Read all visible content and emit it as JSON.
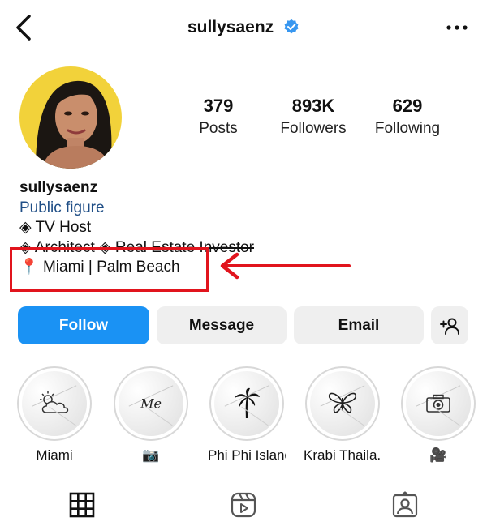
{
  "header": {
    "username": "sullysaenz",
    "back_icon": "chevron-left-icon",
    "verified_icon": "verified-badge-icon",
    "more_icon": "more-horizontal-icon"
  },
  "stats": [
    {
      "value": "379",
      "label": "Posts"
    },
    {
      "value": "893K",
      "label": "Followers"
    },
    {
      "value": "629",
      "label": "Following"
    }
  ],
  "bio": {
    "name": "sullysaenz",
    "category": "Public figure",
    "line1": "◈ TV Host",
    "line2": "◈ Architect ◈ Real Estate Investor",
    "location_icon": "📍",
    "location": "Miami | Palm Beach"
  },
  "actions": {
    "follow": "Follow",
    "message": "Message",
    "email": "Email",
    "add_user_icon": "add-user-icon"
  },
  "highlights": [
    {
      "label": "Miami",
      "icon": "cloud-sun-icon"
    },
    {
      "label": "📷",
      "icon": "me-text-icon",
      "icon_text": "Me"
    },
    {
      "label": "Phi Phi Island",
      "icon": "palm-tree-icon"
    },
    {
      "label": "Krabi Thaila...",
      "icon": "butterfly-icon"
    },
    {
      "label": "🎥",
      "icon": "camera-icon"
    }
  ],
  "tabs": [
    {
      "icon": "grid-icon"
    },
    {
      "icon": "reels-icon"
    },
    {
      "icon": "tagged-icon"
    }
  ],
  "colors": {
    "follow_blue": "#1a92f4",
    "annotation_red": "#e1141d",
    "category_blue": "#1f4e86",
    "verified_blue": "#3897f0"
  }
}
